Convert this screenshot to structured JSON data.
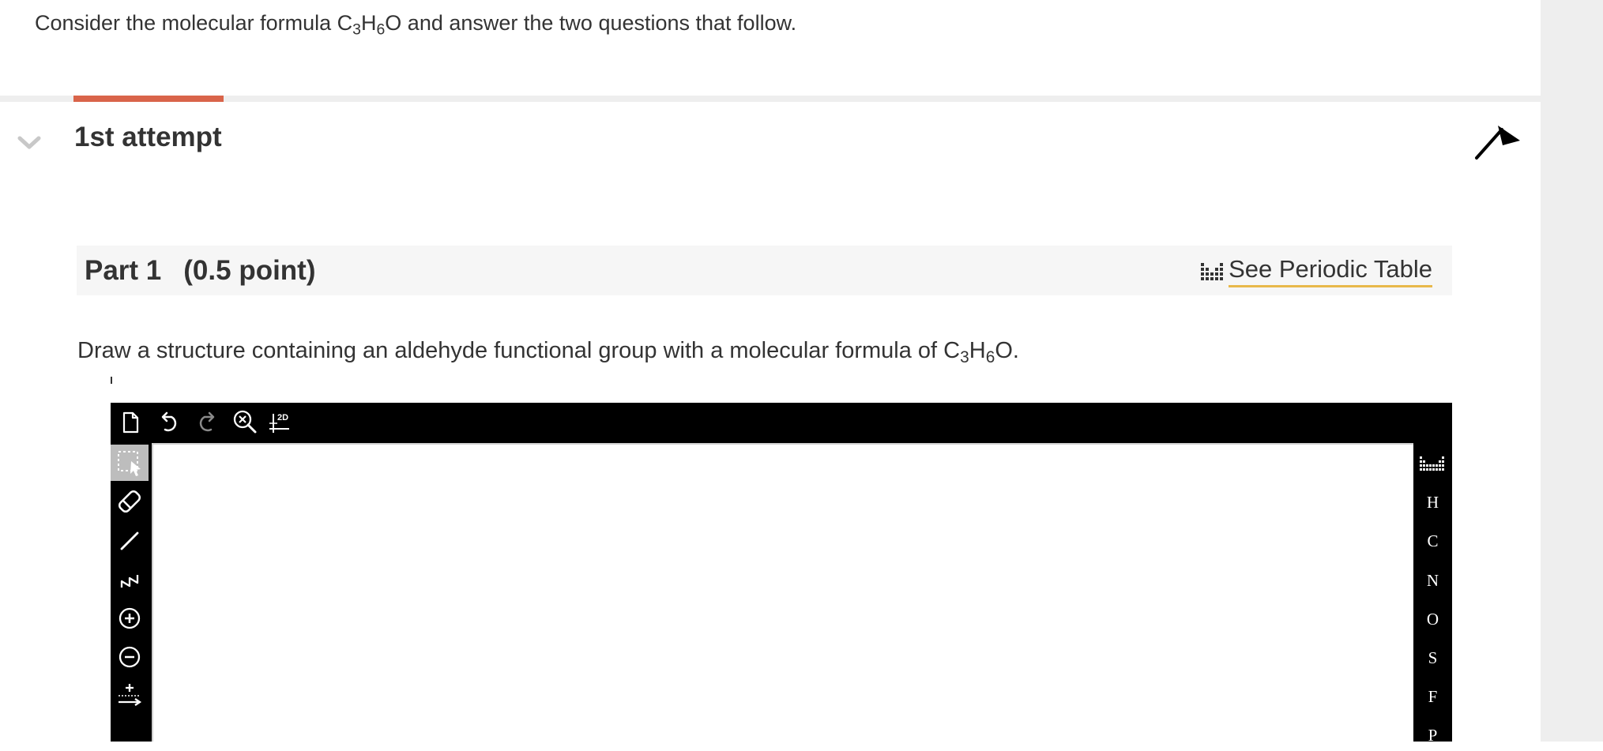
{
  "intro": {
    "before": "Consider the molecular formula C",
    "sub1": "3",
    "mid": "H",
    "sub2": "6",
    "after": "O and answer the two questions that follow."
  },
  "attempt": {
    "title": "1st attempt",
    "progress_fraction": 0.1
  },
  "part": {
    "title": "Part 1",
    "points": "(0.5 point)",
    "periodic_label": "See Periodic Table"
  },
  "question": {
    "before": "Draw a structure containing an aldehyde functional group with a molecular formula of C",
    "sub1": "3",
    "mid": "H",
    "sub2": "6",
    "after": "O."
  },
  "editor": {
    "top_tools": [
      "new-document-icon",
      "undo-icon",
      "redo-icon",
      "zoom-clear-icon",
      "2d-clean-icon"
    ],
    "clean_label": "2D",
    "left_tools": [
      "selection-icon",
      "eraser-icon",
      "single-bond-icon",
      "chain-icon",
      "positive-charge-icon",
      "negative-charge-icon",
      "reaction-arrow-icon"
    ],
    "elements": [
      "H",
      "C",
      "N",
      "O",
      "S",
      "F",
      "P"
    ],
    "colors": {
      "toolbar": "#000000",
      "active_tool": "#bdbdbd",
      "canvas": "#ffffff"
    }
  },
  "colors": {
    "progress": "#d9644a",
    "link_underline": "#e8b84a",
    "text": "#333333"
  }
}
